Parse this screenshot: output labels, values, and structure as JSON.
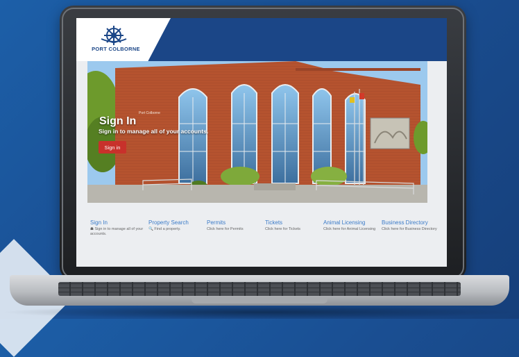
{
  "site": {
    "logo_text": "PORT COLBORNE",
    "hero": {
      "title": "Sign In",
      "subtitle": "Sign in to manage all of your accounts.",
      "button_label": "Sign in",
      "building_caption": "Port Colborne"
    },
    "links": [
      {
        "title": "Sign In",
        "desc": "☗ Sign in to manage all of your accounts."
      },
      {
        "title": "Property Search",
        "desc": "🔍 Find a property."
      },
      {
        "title": "Permits",
        "desc": "Click here for Permits"
      },
      {
        "title": "Tickets",
        "desc": "Click here for Tickets"
      },
      {
        "title": "Animal Licensing",
        "desc": "Click here for Animal Licensing"
      },
      {
        "title": "Business Directory",
        "desc": "Click here for Business Directory"
      }
    ]
  },
  "colors": {
    "brand_blue": "#1b4687",
    "accent_red": "#c8312b",
    "link_blue": "#3b7bc8",
    "background_blue": "#1a4f93"
  }
}
